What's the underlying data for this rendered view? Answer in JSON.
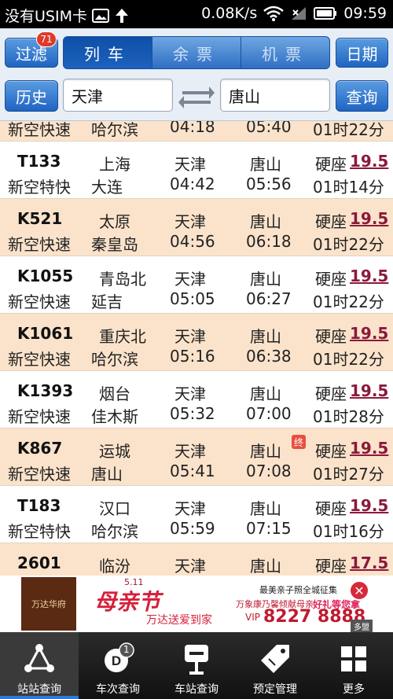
{
  "statusbar": {
    "carrier": "没有USIM卡",
    "speed": "0.08K/s",
    "time": "09:59"
  },
  "header": {
    "filter_label": "过滤",
    "filter_badge": "71",
    "tabs": [
      {
        "label": "列车",
        "active": true
      },
      {
        "label": "余票",
        "active": false
      },
      {
        "label": "机票",
        "active": false
      }
    ],
    "date_label": "日期",
    "history_label": "历史",
    "from_station": "天津",
    "to_station": "唐山",
    "query_label": "查询"
  },
  "trains": [
    {
      "code": "",
      "type": "新空快速",
      "origin": "",
      "dest": "哈尔滨",
      "from": "",
      "to": "",
      "depart": "04:18",
      "arrive": "05:40",
      "seat": "",
      "price": "",
      "duration": "01时22分",
      "end_badge": ""
    },
    {
      "code": "T133",
      "type": "新空特快",
      "origin": "上海",
      "dest": "大连",
      "from": "天津",
      "to": "唐山",
      "depart": "04:42",
      "arrive": "05:56",
      "seat": "硬座",
      "price": "19.5",
      "duration": "01时14分",
      "end_badge": ""
    },
    {
      "code": "K521",
      "type": "新空快速",
      "origin": "太原",
      "dest": "秦皇岛",
      "from": "天津",
      "to": "唐山",
      "depart": "04:56",
      "arrive": "06:18",
      "seat": "硬座",
      "price": "19.5",
      "duration": "01时22分",
      "end_badge": ""
    },
    {
      "code": "K1055",
      "type": "新空快速",
      "origin": "青岛北",
      "dest": "延吉",
      "from": "天津",
      "to": "唐山",
      "depart": "05:05",
      "arrive": "06:27",
      "seat": "硬座",
      "price": "19.5",
      "duration": "01时22分",
      "end_badge": ""
    },
    {
      "code": "K1061",
      "type": "新空快速",
      "origin": "重庆北",
      "dest": "哈尔滨",
      "from": "天津",
      "to": "唐山",
      "depart": "05:16",
      "arrive": "06:38",
      "seat": "硬座",
      "price": "19.5",
      "duration": "01时22分",
      "end_badge": ""
    },
    {
      "code": "K1393",
      "type": "新空快速",
      "origin": "烟台",
      "dest": "佳木斯",
      "from": "天津",
      "to": "唐山",
      "depart": "05:32",
      "arrive": "07:00",
      "seat": "硬座",
      "price": "19.5",
      "duration": "01时28分",
      "end_badge": ""
    },
    {
      "code": "K867",
      "type": "新空快速",
      "origin": "运城",
      "dest": "唐山",
      "from": "天津",
      "to": "唐山",
      "depart": "05:41",
      "arrive": "07:08",
      "seat": "硬座",
      "price": "19.5",
      "duration": "01时27分",
      "end_badge": "终"
    },
    {
      "code": "T183",
      "type": "新空特快",
      "origin": "汉口",
      "dest": "哈尔滨",
      "from": "天津",
      "to": "唐山",
      "depart": "05:59",
      "arrive": "07:15",
      "seat": "硬座",
      "price": "19.5",
      "duration": "01时16分",
      "end_badge": ""
    },
    {
      "code": "2601",
      "type": "",
      "origin": "临汾",
      "dest": "",
      "from": "天津",
      "to": "唐山",
      "depart": "",
      "arrive": "",
      "seat": "硬座",
      "price": "17.5",
      "duration": "",
      "end_badge": ""
    }
  ],
  "ad": {
    "logo": "万达华府",
    "date": "5.11",
    "headline": "母亲节",
    "sub": "万达送爱到家",
    "top_line": "最美亲子照全城征集",
    "mid_line": "万象康乃馨倾献母亲",
    "gift": "好礼等您拿",
    "vip": "VIP",
    "phone": "8227 8888",
    "more": "多盟"
  },
  "bottomnav": [
    {
      "label": "站站查询",
      "icon": "triangle-network-icon",
      "active": true
    },
    {
      "label": "车次查询",
      "icon": "train-d-icon",
      "active": false,
      "badge": "1"
    },
    {
      "label": "车站查询",
      "icon": "station-sign-icon",
      "active": false
    },
    {
      "label": "预定管理",
      "icon": "tag-icon",
      "active": false
    },
    {
      "label": "更多",
      "icon": "grid-icon",
      "active": false
    }
  ]
}
